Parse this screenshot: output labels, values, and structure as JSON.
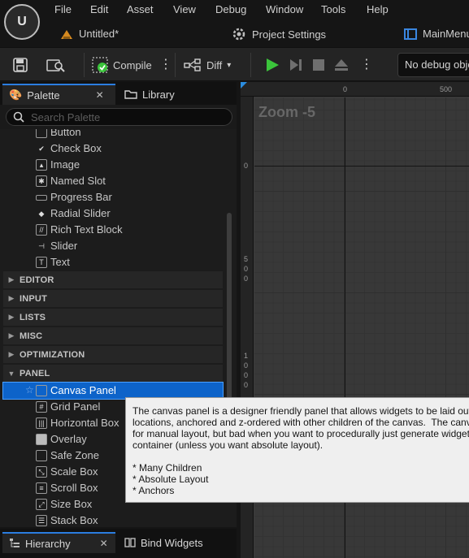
{
  "menu": {
    "items": [
      "File",
      "Edit",
      "Asset",
      "View",
      "Debug",
      "Window",
      "Tools",
      "Help"
    ]
  },
  "tabs": {
    "document": "Untitled*",
    "project_settings": "Project Settings",
    "main_menu": "MainMenu"
  },
  "toolbar": {
    "compile_label": "Compile",
    "diff_label": "Diff",
    "debug_object": "No debug object selected"
  },
  "palette": {
    "tab_label": "Palette",
    "library_label": "Library",
    "search_placeholder": "Search Palette",
    "common_items": [
      {
        "label": "Button",
        "icon": "button-icon"
      },
      {
        "label": "Check Box",
        "icon": "checkbox-icon"
      },
      {
        "label": "Image",
        "icon": "image-icon"
      },
      {
        "label": "Named Slot",
        "icon": "named-slot-icon"
      },
      {
        "label": "Progress Bar",
        "icon": "progress-bar-icon"
      },
      {
        "label": "Radial Slider",
        "icon": "radial-slider-icon"
      },
      {
        "label": "Rich Text Block",
        "icon": "rich-text-icon"
      },
      {
        "label": "Slider",
        "icon": "slider-icon"
      },
      {
        "label": "Text",
        "icon": "text-icon"
      }
    ],
    "categories": [
      "EDITOR",
      "INPUT",
      "LISTS",
      "MISC",
      "OPTIMIZATION",
      "PANEL"
    ],
    "panel_items": [
      {
        "label": "Canvas Panel",
        "icon": "canvas-panel-icon",
        "selected": true
      },
      {
        "label": "Grid Panel",
        "icon": "grid-panel-icon"
      },
      {
        "label": "Horizontal Box",
        "icon": "horizontal-box-icon"
      },
      {
        "label": "Overlay",
        "icon": "overlay-icon"
      },
      {
        "label": "Safe Zone",
        "icon": "safe-zone-icon"
      },
      {
        "label": "Scale Box",
        "icon": "scale-box-icon"
      },
      {
        "label": "Scroll Box",
        "icon": "scroll-box-icon"
      },
      {
        "label": "Size Box",
        "icon": "size-box-icon"
      },
      {
        "label": "Stack Box",
        "icon": "stack-box-icon"
      }
    ]
  },
  "bottom_tabs": {
    "hierarchy": "Hierarchy",
    "bind_widgets": "Bind Widgets"
  },
  "designer": {
    "zoom_label": "Zoom -5",
    "ruler_top": [
      "0",
      "500"
    ],
    "ruler_left": [
      "0",
      "5",
      "0",
      "0",
      "1",
      "0",
      "0",
      "0"
    ]
  },
  "tooltip": {
    "text": "The canvas panel is a designer friendly panel that allows widgets to be laid out at arbitrary\nlocations, anchored and z-ordered with other children of the canvas.  The canvas is a great widget\nfor manual layout, but bad when you want to procedurally just generate widgets and place them in a\ncontainer (unless you want absolute layout).\n\n* Many Children\n* Absolute Layout\n* Anchors"
  },
  "colors": {
    "accent": "#0d63c9",
    "play_green": "#3bc43b",
    "tab_highlight": "#2b7de0"
  }
}
